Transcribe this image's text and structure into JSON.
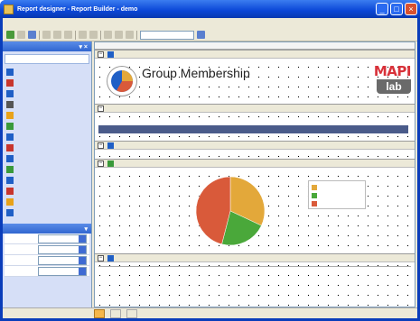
{
  "window": {
    "title": "Report designer - Report Builder - demo"
  },
  "menu": [],
  "sidebar": {
    "toolbox_title": "",
    "toolbox_sub": "",
    "tools": [
      {
        "label": "",
        "icon": "pointer-icon",
        "color": "#1f5fc6"
      },
      {
        "label": "",
        "icon": "label-icon",
        "color": "#c8352d"
      },
      {
        "label": "",
        "icon": "textbox-icon",
        "color": "#1f5fc6"
      },
      {
        "label": "",
        "icon": "line-icon",
        "color": "#555555"
      },
      {
        "label": "",
        "icon": "rectangle-icon",
        "color": "#e8a21a"
      },
      {
        "label": "",
        "icon": "chart-icon",
        "color": "#3a9a3a"
      },
      {
        "label": "",
        "icon": "table-icon",
        "color": "#1f5fc6"
      },
      {
        "label": "",
        "icon": "matrix-icon",
        "color": "#c8352d"
      },
      {
        "label": "",
        "icon": "list-icon",
        "color": "#1f5fc6"
      },
      {
        "label": "",
        "icon": "image-icon",
        "color": "#3a9a3a"
      },
      {
        "label": "",
        "icon": "subreport-icon",
        "color": "#1f5fc6"
      },
      {
        "label": "",
        "icon": "barcode-icon",
        "color": "#c8352d"
      },
      {
        "label": "",
        "icon": "checkbox-icon",
        "color": "#e8a21a"
      },
      {
        "label": "",
        "icon": "shape-icon",
        "color": "#1f5fc6"
      }
    ],
    "properties_title": "",
    "properties": [
      {
        "label": "",
        "value": ""
      },
      {
        "label": "",
        "value": ""
      },
      {
        "label": "",
        "value": ""
      },
      {
        "label": "",
        "value": ""
      }
    ]
  },
  "report": {
    "title": "Group Membership",
    "subtitle": "",
    "logo_top": "MAPI",
    "logo_bottom": "lab",
    "header_band_label": "",
    "link_left": "",
    "link_right": "",
    "columns": [
      "",
      "",
      "",
      ""
    ],
    "detail_band_label": "",
    "detail_fields": [
      "",
      "",
      ""
    ],
    "chart_band_label": "",
    "footer_band_label": "",
    "footer_text": ""
  },
  "status": {
    "tabs": [
      "",
      "",
      ""
    ],
    "right_text": ""
  },
  "chart_data": {
    "type": "pie",
    "categories": [
      "",
      "",
      ""
    ],
    "values": [
      32,
      22,
      46
    ],
    "colors": [
      "#e3a83a",
      "#4aa83a",
      "#d95a3a"
    ],
    "title": ""
  }
}
